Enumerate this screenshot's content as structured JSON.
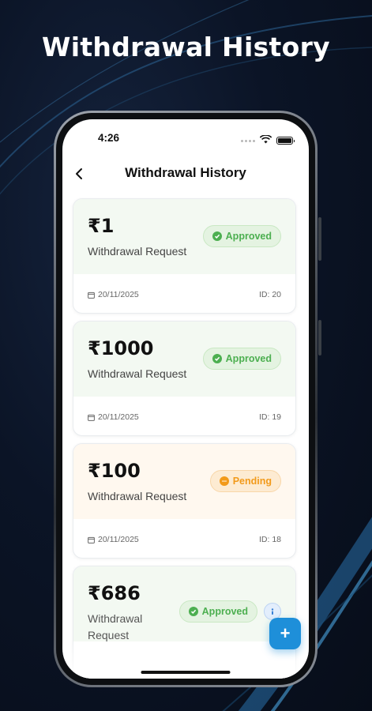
{
  "headline": "Withdrawal History",
  "status_bar": {
    "time": "4:26"
  },
  "app_bar": {
    "title": "Withdrawal History"
  },
  "colors": {
    "approved": "#4caf50",
    "pending": "#f29a1a",
    "fab": "#1e8fd9"
  },
  "withdrawals": [
    {
      "amount": "₹1",
      "label": "Withdrawal Request",
      "status": "Approved",
      "date": "20/11/2025",
      "id": "ID: 20"
    },
    {
      "amount": "₹1000",
      "label": "Withdrawal Request",
      "status": "Approved",
      "date": "20/11/2025",
      "id": "ID: 19"
    },
    {
      "amount": "₹100",
      "label": "Withdrawal Request",
      "status": "Pending",
      "date": "20/11/2025",
      "id": "ID: 18"
    },
    {
      "amount": "₹686",
      "label": "Withdrawal Request",
      "status": "Approved"
    }
  ],
  "fab": {
    "label": "+"
  }
}
